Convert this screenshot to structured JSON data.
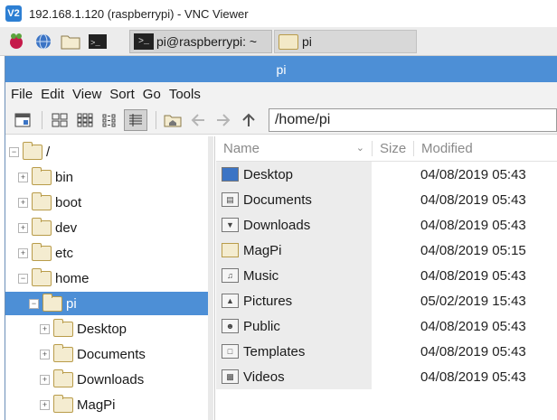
{
  "vnc": {
    "title": "192.168.1.120 (raspberrypi) - VNC Viewer",
    "logo": "V2"
  },
  "panel": {
    "icons": [
      "raspberry-icon",
      "globe-icon",
      "folder-icon",
      "terminal-icon"
    ],
    "tasks": [
      {
        "label": "pi@raspberrypi: ~",
        "icon": "terminal-icon"
      },
      {
        "label": "pi",
        "icon": "folder-icon"
      }
    ]
  },
  "file_manager": {
    "title": "pi",
    "menu": [
      "File",
      "Edit",
      "View",
      "Sort",
      "Go",
      "Tools"
    ],
    "path": "/home/pi"
  },
  "tree": [
    {
      "label": "/",
      "expander": "−"
    },
    {
      "label": "bin",
      "expander": "+"
    },
    {
      "label": "boot",
      "expander": "+"
    },
    {
      "label": "dev",
      "expander": "+"
    },
    {
      "label": "etc",
      "expander": "+"
    },
    {
      "label": "home",
      "expander": "−"
    },
    {
      "label": "pi",
      "expander": "−",
      "selected": true
    },
    {
      "label": "Desktop",
      "expander": "+"
    },
    {
      "label": "Documents",
      "expander": "+"
    },
    {
      "label": "Downloads",
      "expander": "+"
    },
    {
      "label": "MagPi",
      "expander": "+"
    }
  ],
  "list": {
    "columns": {
      "name": "Name",
      "size": "Size",
      "modified": "Modified"
    },
    "files": [
      {
        "name": "Desktop",
        "modified": "04/08/2019 05:43",
        "icon": "desktop-icon"
      },
      {
        "name": "Documents",
        "modified": "04/08/2019 05:43",
        "icon": "documents-icon"
      },
      {
        "name": "Downloads",
        "modified": "04/08/2019 05:43",
        "icon": "downloads-icon"
      },
      {
        "name": "MagPi",
        "modified": "04/08/2019 05:15",
        "icon": "folder-icon"
      },
      {
        "name": "Music",
        "modified": "04/08/2019 05:43",
        "icon": "music-icon"
      },
      {
        "name": "Pictures",
        "modified": "05/02/2019 15:43",
        "icon": "pictures-icon"
      },
      {
        "name": "Public",
        "modified": "04/08/2019 05:43",
        "icon": "public-icon"
      },
      {
        "name": "Templates",
        "modified": "04/08/2019 05:43",
        "icon": "templates-icon"
      },
      {
        "name": "Videos",
        "modified": "04/08/2019 05:43",
        "icon": "videos-icon"
      }
    ]
  },
  "colors": {
    "accent": "#4d8fd6",
    "panel": "#ececec"
  }
}
